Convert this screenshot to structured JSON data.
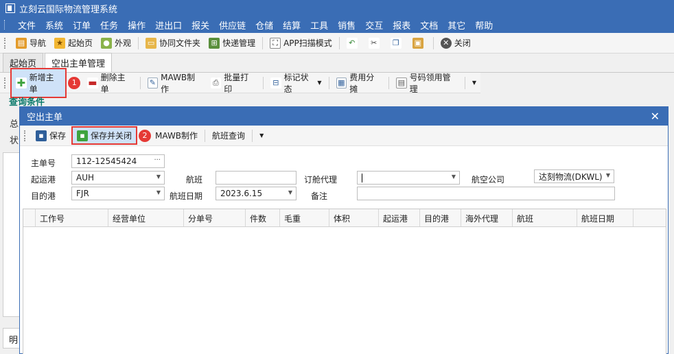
{
  "app": {
    "title": "立刻云国际物流管理系统"
  },
  "menu": [
    "文件",
    "系统",
    "订单",
    "任务",
    "操作",
    "进出口",
    "报关",
    "供应链",
    "仓储",
    "结算",
    "工具",
    "销售",
    "交互",
    "报表",
    "文档",
    "其它",
    "帮助"
  ],
  "toolbar": {
    "nav": "导航",
    "home": "起始页",
    "skin": "外观",
    "shared": "协同文件夹",
    "express": "快递管理",
    "app_scan": "APP扫描模式",
    "close": "关闭"
  },
  "tabs": [
    "起始页",
    "空出主单管理"
  ],
  "list_toolbar": {
    "add_master": "新增主单",
    "delete_master": "删除主单",
    "mawb": "MAWB制作",
    "batch_print": "批量打印",
    "mark_status": "标记状态",
    "cost_split": "费用分摊",
    "number_usage": "号码领用管理"
  },
  "badges": [
    "1",
    "2"
  ],
  "query": {
    "label": "查询条件"
  },
  "background_fragments": {
    "left1": "总",
    "left2": "状",
    "bottom": "明"
  },
  "dialog": {
    "title": "空出主单",
    "toolbar": {
      "save": "保存",
      "save_close": "保存并关闭",
      "mawb": "MAWB制作",
      "flight_query": "航班查询"
    },
    "form": {
      "master_no_label": "主单号",
      "master_no": "112-12545424",
      "origin_label": "起运港",
      "origin": "AUH",
      "flight_label": "航班",
      "flight": "",
      "booking_agent_label": "订舱代理",
      "booking_agent": "",
      "airline_label": "航空公司",
      "airline": "达刻物流(DKWL)",
      "dest_label": "目的港",
      "dest": "FJR",
      "flight_date_label": "航班日期",
      "flight_date": "2023.6.15",
      "remark_label": "备注",
      "remark": ""
    },
    "grid": {
      "columns": [
        "工作号",
        "经营单位",
        "分单号",
        "件数",
        "毛重",
        "体积",
        "起运港",
        "目的港",
        "海外代理",
        "航班",
        "航班日期"
      ]
    }
  }
}
